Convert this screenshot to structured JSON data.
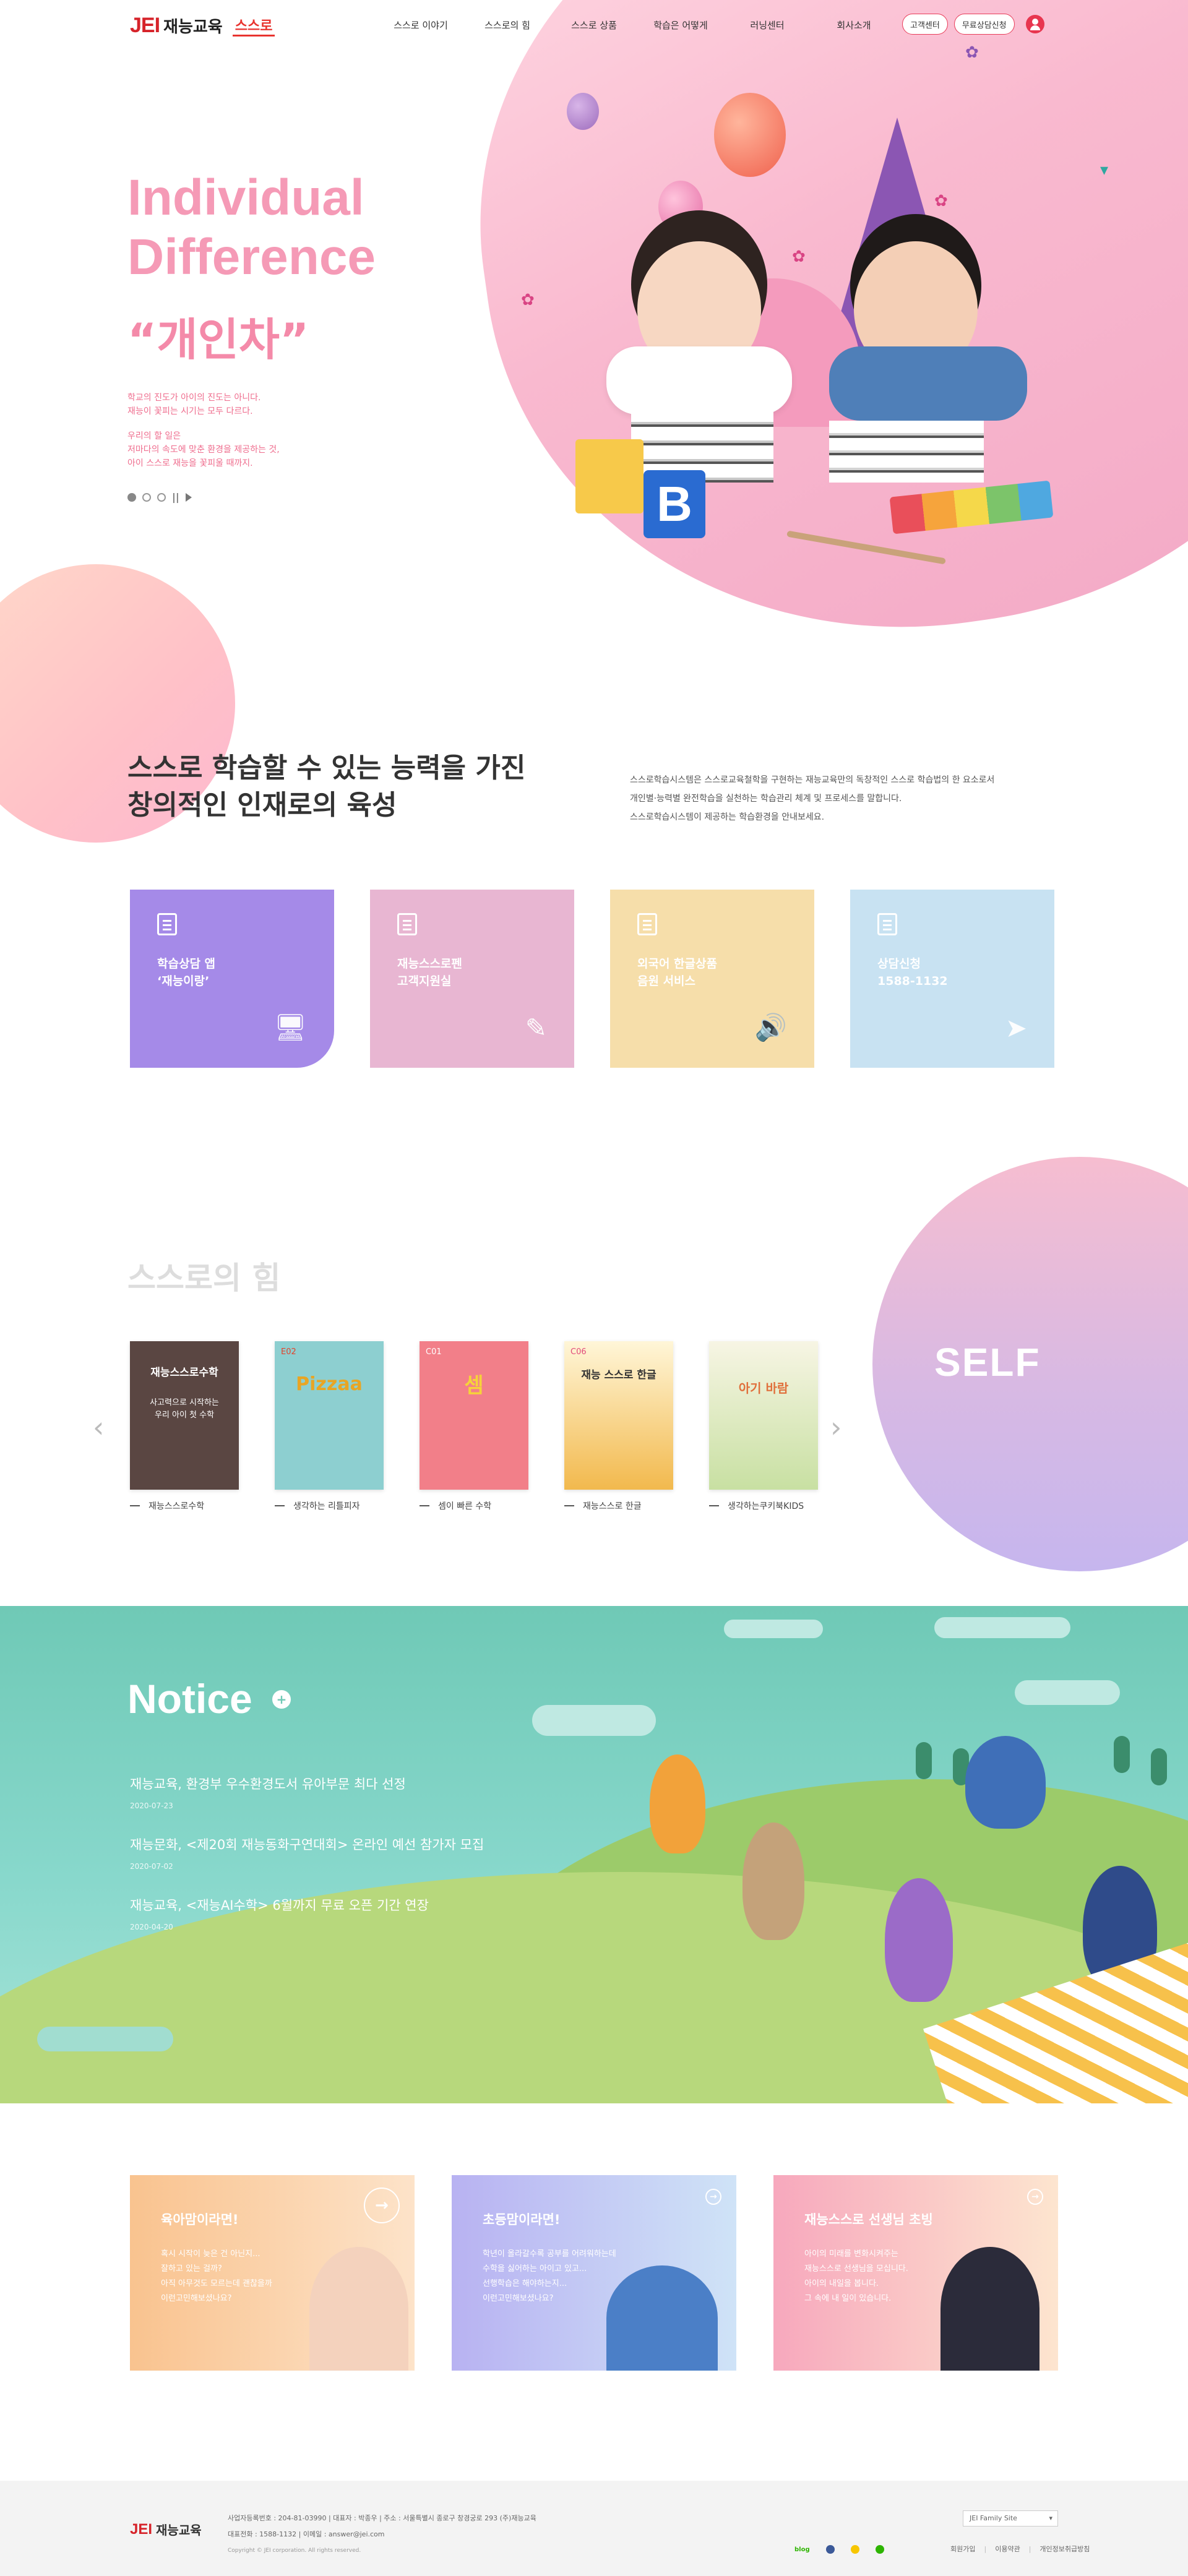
{
  "header": {
    "logo_brand": "JEI",
    "logo_name": "재능교육",
    "logo_sub": "스스로",
    "nav": [
      "스스로 이야기",
      "스스로의 힘",
      "스스로 상품",
      "학습은 어떻게",
      "러닝센터",
      "회사소개"
    ],
    "btn_customer": "고객센터",
    "btn_consult": "무료상담신청"
  },
  "hero": {
    "title_line1": "Individual",
    "title_line2": "Difference",
    "title_ko": "“개인차”",
    "desc_1a": "학교의 진도가 아이의 진도는 아니다.",
    "desc_1b": "재능이 꽃피는 시기는 모두 다르다.",
    "desc_2a": "우리의 할 일은",
    "desc_2b": "저마다의 속도에 맞춘 환경을 제공하는 것,",
    "desc_2c": "아이 스스로 재능을 꽃피울 때까지."
  },
  "intro": {
    "title_line1": "스스로 학습할 수 있는 능력을 가진",
    "title_line2": "창의적인 인재로의 육성",
    "desc_1": "스스로학습시스템은 스스로교육철학을 구현하는 재능교육만의 독창적인 스스로 학습법의 한 요소로서",
    "desc_2": "개인별·능력별 완전학습을 실천하는 학습관리 체계 및 프로세스를 말합니다.",
    "desc_3": "스스로학습시스템이 제공하는 학습환경을 안내보세요."
  },
  "cards": [
    {
      "line1": "학습상담 앱",
      "line2": "‘재능이랑’",
      "icon": "monitor-icon"
    },
    {
      "line1": "재능스스로펜",
      "line2": "고객지원실",
      "icon": "pen-icon"
    },
    {
      "line1": "외국어 한글상품",
      "line2": "음원 서비스",
      "icon": "speaker-icon"
    },
    {
      "line1": "상담신청",
      "line2": "1588-1132",
      "icon": "send-icon"
    }
  ],
  "self": {
    "title": "스스로의 힘",
    "badge": "SELF",
    "books": [
      {
        "cover_title": "재능스스로수학",
        "cover_sub_1": "사고력으로 시작하는",
        "cover_sub_2": "우리 아이 첫 수학",
        "caption": "재능스스로수학"
      },
      {
        "cover_title": "Pizzaa",
        "cover_sub_1": "E02",
        "cover_sub_2": "",
        "caption": "생각하는 리틀피자"
      },
      {
        "cover_title": "셈",
        "cover_sub_1": "C01",
        "cover_sub_2": "",
        "caption": "셈이 빠른 수학"
      },
      {
        "cover_title": "재능 스스로 한글",
        "cover_sub_1": "C06",
        "cover_sub_2": "",
        "caption": "재능스스로 한글"
      },
      {
        "cover_title": "아기 바람",
        "cover_sub_1": "",
        "cover_sub_2": "",
        "caption": "생각하는쿠키북KIDS"
      }
    ]
  },
  "notice": {
    "title": "Notice",
    "more": "+",
    "items": [
      {
        "title": "재능교육, 환경부 우수환경도서 유아부문 최다 선정",
        "date": "2020-07-23"
      },
      {
        "title": "재능문화, <제20회 재능동화구연대회> 온라인 예선 참가자 모집",
        "date": "2020-07-02"
      },
      {
        "title": "재능교육, <재능AI수학> 6월까지 무료 오픈 기간 연장",
        "date": "2020-04-20"
      }
    ]
  },
  "banners": [
    {
      "title": "육아맘이라면!",
      "line1": "혹시 시작이 늦은 건 아닌지...",
      "line2": "잘하고 있는 걸까?",
      "line3": "아직 아무것도 모르는데 괜찮을까",
      "line4": "이런고민해보셨나요?"
    },
    {
      "title": "초등맘이라면!",
      "line1": "학년이 올라갈수록 공부를 어려워하는데",
      "line2": "수학을 싫어하는 아이고 있고...",
      "line3": "선행학습은 해야하는지...",
      "line4": "이런고민해보셨나요?"
    },
    {
      "title": "재능스스로 선생님 초빙",
      "line1": "아이의 미래를 변화시켜주는",
      "line2": "재능스스로 선생님을 모십니다.",
      "line3": "아이의 내일을 봅니다.",
      "line4": "그 속에 내 일이 있습니다."
    }
  ],
  "footer": {
    "brand": "JEI",
    "name": "재능교육",
    "info_1": "사업자등록번호 : 204-81-03990  |  대표자 : 박종우  |  주소 : 서울특별시 종로구 창경궁로 293 (주)재능교육",
    "info_2": "대표전화 : 1588-1132  |  이메일 : answer@jei.com",
    "copyright": "Copyright © JEI corporation. All rights reserved.",
    "family_site": "JEI Family Site",
    "sns_blog": "blog",
    "links": [
      "회원가입",
      "이용약관",
      "개인정보취급방침"
    ]
  }
}
